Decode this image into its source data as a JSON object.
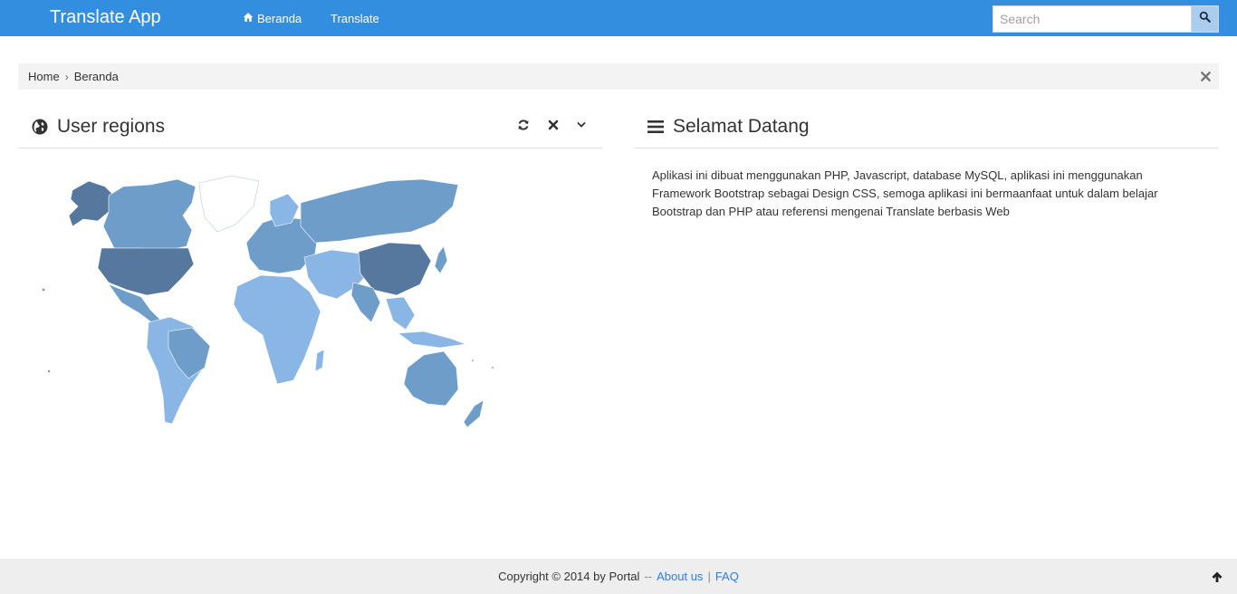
{
  "navbar": {
    "brand": "Translate App",
    "items": [
      {
        "label": "Beranda",
        "icon": "home-icon"
      },
      {
        "label": "Translate"
      }
    ],
    "search": {
      "placeholder": "Search",
      "button_icon": "search-icon"
    }
  },
  "breadcrumb": {
    "items": [
      "Home",
      "Beranda"
    ],
    "close_icon": "close-icon"
  },
  "panels": {
    "left": {
      "title": "User regions",
      "icon": "globe-icon",
      "controls": [
        "refresh-icon",
        "close-icon",
        "chevron-down-icon"
      ]
    },
    "right": {
      "title": "Selamat Datang",
      "icon": "bars-icon",
      "body": "Aplikasi ini dibuat menggunakan PHP, Javascript, database MySQL, aplikasi ini menggunakan Framework Bootstrap sebagai Design CSS, semoga aplikasi ini bermaanfaat untuk dalam belajar Bootstrap dan PHP atau referensi mengenai Translate berbasis Web"
    }
  },
  "footer": {
    "copyright": "Copyright © 2014 by Portal",
    "separator1": "--",
    "about": "About us",
    "separator2": "|",
    "faq": "FAQ",
    "top_icon": "arrow-up-icon"
  },
  "colors": {
    "navbar": "#348ee0",
    "map_light": "#8ab6e6",
    "map_mid": "#6e9dca",
    "map_dark": "#56789f",
    "link": "#2f7ed8"
  }
}
